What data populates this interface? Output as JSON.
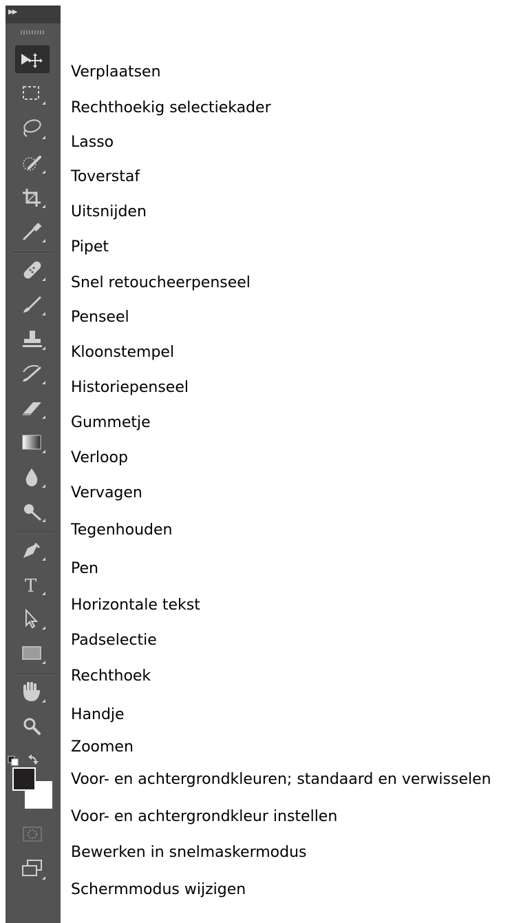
{
  "tools": [
    {
      "icon": "move-icon",
      "label": "Verplaatsen"
    },
    {
      "icon": "rectangular-marquee-icon",
      "label": "Rechthoekig selectiekader"
    },
    {
      "icon": "lasso-icon",
      "label": "Lasso"
    },
    {
      "icon": "magic-wand-icon",
      "label": "Toverstaf"
    },
    {
      "icon": "crop-icon",
      "label": "Uitsnijden"
    },
    {
      "icon": "eyedropper-icon",
      "label": "Pipet"
    },
    {
      "icon": "healing-brush-icon",
      "label": "Snel retoucheerpenseel"
    },
    {
      "icon": "brush-icon",
      "label": "Penseel"
    },
    {
      "icon": "clone-stamp-icon",
      "label": "Kloonstempel"
    },
    {
      "icon": "history-brush-icon",
      "label": "Historiepenseel"
    },
    {
      "icon": "eraser-icon",
      "label": "Gummetje"
    },
    {
      "icon": "gradient-icon",
      "label": "Verloop"
    },
    {
      "icon": "blur-icon",
      "label": "Vervagen"
    },
    {
      "icon": "dodge-icon",
      "label": "Tegenhouden"
    },
    {
      "icon": "pen-icon",
      "label": "Pen"
    },
    {
      "icon": "horizontal-type-icon",
      "label": "Horizontale tekst"
    },
    {
      "icon": "path-selection-icon",
      "label": "Padselectie"
    },
    {
      "icon": "rectangle-shape-icon",
      "label": "Rechthoek"
    },
    {
      "icon": "hand-icon",
      "label": "Handje"
    },
    {
      "icon": "zoom-icon",
      "label": "Zoomen"
    },
    {
      "icon": "default-swap-colors-icon",
      "label": "Voor- en achtergrondkleuren; standaard en verwisselen"
    },
    {
      "icon": "color-swatches-icon",
      "label": "Voor- en achtergrondkleur instellen"
    },
    {
      "icon": "quick-mask-icon",
      "label": "Bewerken in snelmaskermodus"
    },
    {
      "icon": "screen-mode-icon",
      "label": "Schermmodus wijzigen"
    }
  ],
  "colors": {
    "toolbar": "#535353",
    "foreground": "#231f20",
    "background": "#ffffff"
  }
}
